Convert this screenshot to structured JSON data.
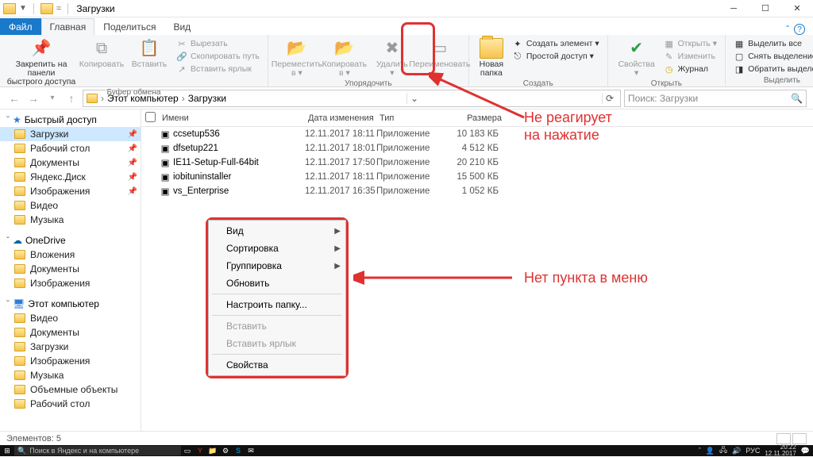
{
  "window": {
    "title": "Загрузки"
  },
  "tabs": {
    "file": "Файл",
    "home": "Главная",
    "share": "Поделиться",
    "view": "Вид"
  },
  "ribbon": {
    "clipboard": {
      "pin": "Закрепить на панели\nбыстрого доступа",
      "copy": "Копировать",
      "paste": "Вставить",
      "cut": "Вырезать",
      "copy_path": "Скопировать путь",
      "paste_shortcut": "Вставить ярлык",
      "caption": "Буфер обмена"
    },
    "organize": {
      "move": "Переместить\nв ▾",
      "copy_to": "Копировать\nв ▾",
      "delete": "Удалить\n▾",
      "rename": "Переименовать",
      "caption": "Упорядочить"
    },
    "new": {
      "new_folder": "Новая\nпапка",
      "new_item": "Создать элемент ▾",
      "easy_access": "Простой доступ ▾",
      "caption": "Создать"
    },
    "open_group": {
      "properties": "Свойства\n▾",
      "open": "Открыть ▾",
      "edit": "Изменить",
      "history": "Журнал",
      "caption": "Открыть"
    },
    "select": {
      "select_all": "Выделить все",
      "select_none": "Снять выделение",
      "invert": "Обратить выделение",
      "caption": "Выделить"
    }
  },
  "breadcrumb": {
    "root": "Этот компьютер",
    "current": "Загрузки"
  },
  "search_placeholder": "Поиск: Загрузки",
  "columns": {
    "name": "Имени",
    "date": "Дата изменения",
    "type": "Тип",
    "size": "Размера"
  },
  "files": [
    {
      "name": "ccsetup536",
      "date": "12.11.2017 18:11",
      "type": "Приложение",
      "size": "10 183 КБ"
    },
    {
      "name": "dfsetup221",
      "date": "12.11.2017 18:01",
      "type": "Приложение",
      "size": "4 512 КБ"
    },
    {
      "name": "IE11-Setup-Full-64bit",
      "date": "12.11.2017 17:50",
      "type": "Приложение",
      "size": "20 210 КБ"
    },
    {
      "name": "iobituninstaller",
      "date": "12.11.2017 18:11",
      "type": "Приложение",
      "size": "15 500 КБ"
    },
    {
      "name": "vs_Enterprise",
      "date": "12.11.2017 16:35",
      "type": "Приложение",
      "size": "1 052 КБ"
    }
  ],
  "sidebar": {
    "quick": {
      "label": "Быстрый доступ",
      "items": [
        {
          "label": "Загрузки",
          "pinned": true,
          "selected": true
        },
        {
          "label": "Рабочий стол",
          "pinned": true
        },
        {
          "label": "Документы",
          "pinned": true
        },
        {
          "label": "Яндекс.Диск",
          "pinned": true
        },
        {
          "label": "Изображения",
          "pinned": true
        },
        {
          "label": "Видео"
        },
        {
          "label": "Музыка"
        }
      ]
    },
    "onedrive": {
      "label": "OneDrive",
      "items": [
        {
          "label": "Вложения"
        },
        {
          "label": "Документы"
        },
        {
          "label": "Изображения"
        }
      ]
    },
    "thispc": {
      "label": "Этот компьютер",
      "items": [
        {
          "label": "Видео"
        },
        {
          "label": "Документы"
        },
        {
          "label": "Загрузки"
        },
        {
          "label": "Изображения"
        },
        {
          "label": "Музыка"
        },
        {
          "label": "Объемные объекты"
        },
        {
          "label": "Рабочий стол"
        }
      ]
    }
  },
  "context_menu": [
    {
      "label": "Вид",
      "sub": true
    },
    {
      "label": "Сортировка",
      "sub": true
    },
    {
      "label": "Группировка",
      "sub": true
    },
    {
      "label": "Обновить"
    },
    {
      "sep": true
    },
    {
      "label": "Настроить папку..."
    },
    {
      "sep": true
    },
    {
      "label": "Вставить",
      "disabled": true
    },
    {
      "label": "Вставить ярлык",
      "disabled": true
    },
    {
      "sep": true
    },
    {
      "label": "Свойства"
    }
  ],
  "annotations": {
    "a1_line1": "Не реагирует",
    "a1_line2": "на нажатие",
    "a2": "Нет пункта в меню"
  },
  "status": {
    "elements": "Элементов: 5"
  },
  "taskbar": {
    "search": "Поиск в Яндекс и на компьютере",
    "time": "20:22",
    "date": "12.11.2017",
    "lang": "РУС"
  }
}
